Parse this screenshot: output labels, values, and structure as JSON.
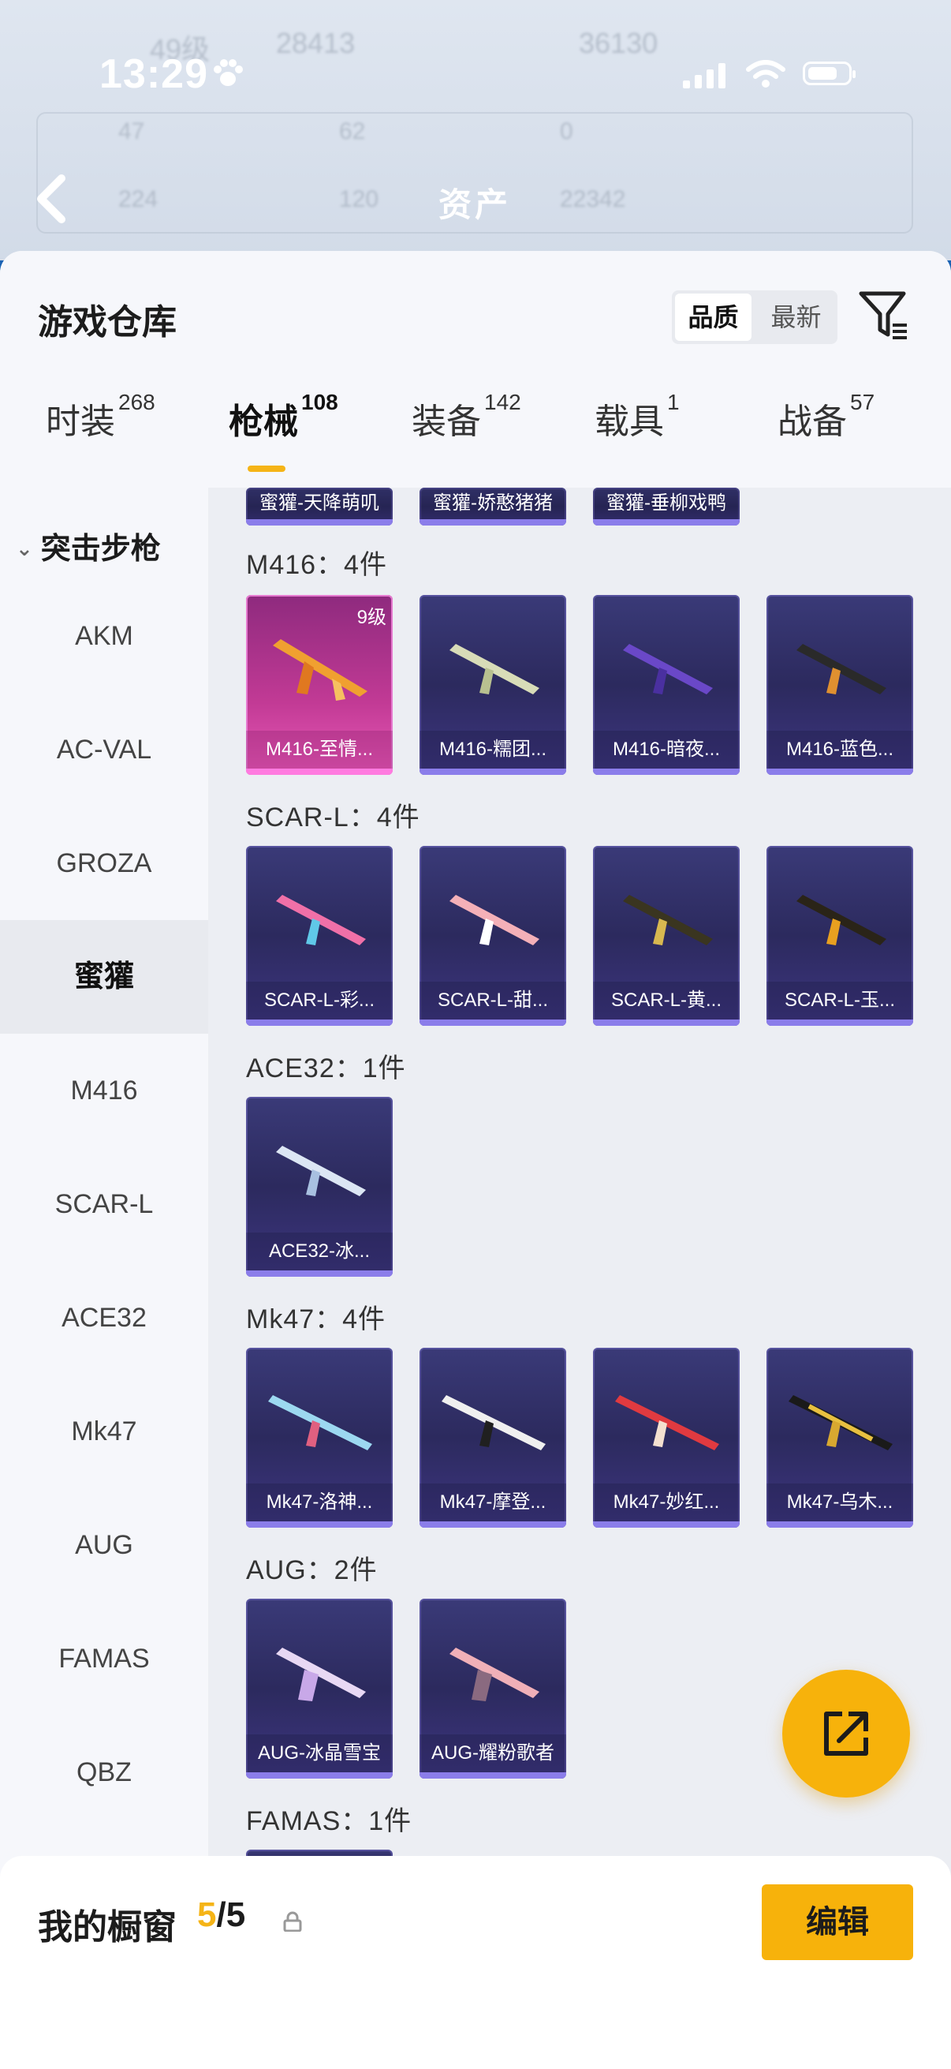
{
  "status_bar": {
    "time": "13:29"
  },
  "header": {
    "title": "资产",
    "ghost_level": "49级",
    "ghost_n1": "28413",
    "ghost_n2": "36130",
    "ghost_stats": [
      "47",
      "62",
      "0",
      "224",
      "120",
      "22342"
    ]
  },
  "sheet": {
    "title": "游戏仓库",
    "sort_options": [
      "品质",
      "最新"
    ],
    "active_sort": "品质"
  },
  "tabs": [
    {
      "label": "时装",
      "count": "268"
    },
    {
      "label": "枪械",
      "count": "108"
    },
    {
      "label": "装备",
      "count": "142"
    },
    {
      "label": "载具",
      "count": "1"
    },
    {
      "label": "战备",
      "count": "57"
    }
  ],
  "active_tab": "枪械",
  "sidebar": {
    "category": "突击步枪",
    "items": [
      "AKM",
      "AC-VAL",
      "GROZA",
      "蜜獾",
      "M416",
      "SCAR-L",
      "ACE32",
      "Mk47",
      "AUG",
      "FAMAS",
      "QBZ"
    ],
    "active": "蜜獾"
  },
  "groups": [
    {
      "title": "",
      "items": [
        "蜜獾-天降萌叽",
        "蜜獾-娇憨猪猪",
        "蜜獾-垂柳戏鸭"
      ]
    },
    {
      "title": "M416：4件",
      "items": [
        "M416-至情...",
        "M416-糯团...",
        "M416-暗夜...",
        "M416-蓝色..."
      ],
      "level": "9级"
    },
    {
      "title": "SCAR-L：4件",
      "items": [
        "SCAR-L-彩...",
        "SCAR-L-甜...",
        "SCAR-L-黄...",
        "SCAR-L-玉..."
      ]
    },
    {
      "title": "ACE32：1件",
      "items": [
        "ACE32-冰..."
      ]
    },
    {
      "title": "Mk47：4件",
      "items": [
        "Mk47-洛神...",
        "Mk47-摩登...",
        "Mk47-妙红...",
        "Mk47-乌木..."
      ]
    },
    {
      "title": "AUG：2件",
      "items": [
        "AUG-冰晶雪宝",
        "AUG-耀粉歌者"
      ]
    },
    {
      "title": "FAMAS：1件",
      "items": []
    }
  ],
  "bottom_bar": {
    "label": "我的橱窗",
    "count_current": "5",
    "count_total": "/5",
    "edit_label": "编辑"
  },
  "colors": {
    "accent": "#f5b417",
    "card_bg": "#2c2a5e",
    "card_pink": "#c23a95"
  }
}
